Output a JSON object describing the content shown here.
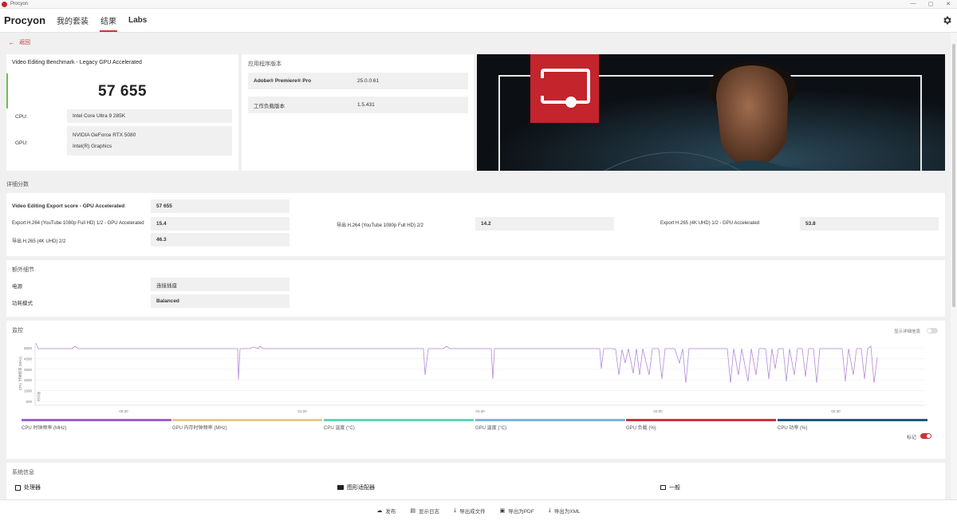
{
  "window": {
    "title": "Procyon",
    "controls": [
      "—",
      "▢",
      "✕"
    ]
  },
  "nav": {
    "brand": "Procyon",
    "tabs": [
      {
        "label": "我的套装",
        "active": false
      },
      {
        "label": "结果",
        "active": true
      },
      {
        "label": "Labs",
        "active": false
      }
    ]
  },
  "back_label": "返回",
  "score": {
    "title": "Video Editing Benchmark - Legacy GPU Accelerated",
    "value": "57 655",
    "cpu_label": "CPU:",
    "cpu_value": "Intel Core Ultra 9 285K",
    "gpu_label": "GPU:",
    "gpu_values": [
      "NVIDIA GeForce RTX 5080",
      "Intel(R) Graphics"
    ]
  },
  "app_version": {
    "header": "应用程序版本",
    "rows": [
      {
        "label": "Adobe® Premiere® Pro",
        "value": "25.0.0.61"
      },
      {
        "label": "工作负载版本",
        "value": "1.5.431"
      }
    ]
  },
  "detail_scores": {
    "header": "详细分数",
    "main_label": "Video Editing Export score - GPU Accelerated",
    "main_value": "57 655",
    "items": [
      {
        "label": "Export H.264 (YouTube 1080p Full HD) 1/2 - GPU Accelerated",
        "value": "15.4"
      },
      {
        "label": "导出 H.264 (YouTube 1080p Full HD) 2/2",
        "value": "14.2"
      },
      {
        "label": "Export H.265 (4K UHD) 1/2 - GPU Accelerated",
        "value": "53.8"
      },
      {
        "label": "导出 H.265 (4K UHD) 2/2",
        "value": "46.3"
      }
    ]
  },
  "extra_details": {
    "header": "额外细节",
    "rows": [
      {
        "label": "电源",
        "value": "连接插座"
      },
      {
        "label": "功耗模式",
        "value": "Balanced"
      }
    ]
  },
  "monitoring": {
    "header": "监控",
    "detail_toggle_label": "显示详细信息",
    "y_axis_label": "CPU 时钟频率 (MHz)",
    "x_axis_note": "时间轴",
    "y_ticks": [
      "5500",
      "4500",
      "3500",
      "2500",
      "1500",
      "500"
    ],
    "x_ticks": [
      "00:30",
      "01:00",
      "01:30",
      "02:00",
      "02:30"
    ],
    "markers_label": "标记",
    "markers_on": true,
    "legend": [
      {
        "label": "CPU 时钟频率 (MHz)",
        "color": "#9b63c9"
      },
      {
        "label": "GPU 内存时钟频率 (MHz)",
        "color": "#e8c88a"
      },
      {
        "label": "CPU 温度 (°C)",
        "color": "#5fd6b3"
      },
      {
        "label": "GPU 温度 (°C)",
        "color": "#7fb4e0"
      },
      {
        "label": "GPU 负载 (%)",
        "color": "#c8343c"
      },
      {
        "label": "CPU 功率 (%)",
        "color": "#1f5a7a"
      }
    ]
  },
  "system_info": {
    "header": "系统信息",
    "sections": [
      {
        "label": "处理器",
        "icon": "processor-icon"
      },
      {
        "label": "图形适配器",
        "icon": "graphics-card-icon"
      },
      {
        "label": "一般",
        "icon": "general-icon"
      }
    ]
  },
  "bottom_actions": [
    {
      "label": "发布",
      "icon": "publish-icon"
    },
    {
      "label": "显示日志",
      "icon": "log-icon"
    },
    {
      "label": "导出成文件",
      "icon": "download-icon"
    },
    {
      "label": "导出为PDF",
      "icon": "pdf-icon"
    },
    {
      "label": "导出为XML",
      "icon": "download-icon"
    }
  ],
  "colors": {
    "accent_red": "#c8343c",
    "score_accent": "#6fbf4a",
    "hero_tile": "#c4242c"
  }
}
